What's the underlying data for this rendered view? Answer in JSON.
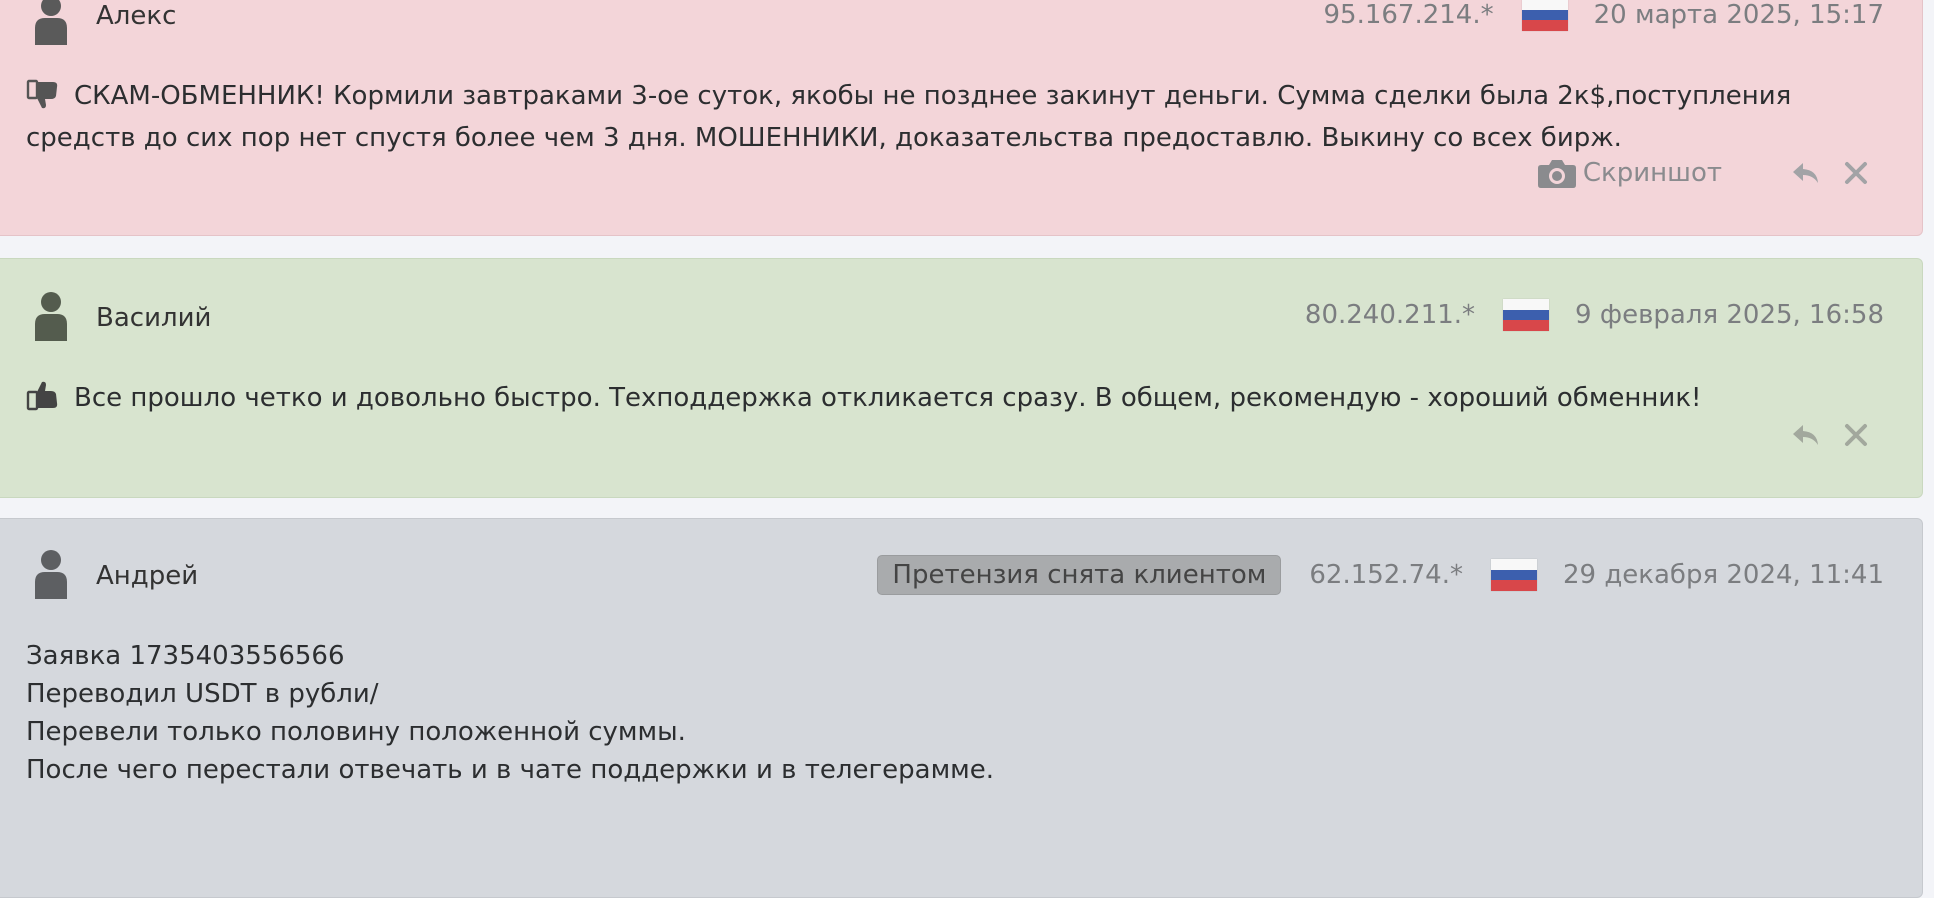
{
  "reviews": [
    {
      "author": "Алекс",
      "ip": "95.167.214.*",
      "date": "20 марта 2025, 15:17",
      "sentiment": "negative",
      "text": "СКАМ-ОБМЕННИК! Кормили завтраками 3-ое суток, якобы не позднее закинут деньги. Сумма сделки была 2к$,поступления средств до сих пор нет спустя более чем 3 дня. МОШЕННИКИ, доказательства предоставлю. Выкину со всех бирж.",
      "screenshot_label": "Скриншот"
    },
    {
      "author": "Василий",
      "ip": "80.240.211.*",
      "date": "9 февраля 2025, 16:58",
      "sentiment": "positive",
      "text": "Все прошло четко и довольно быстро. Техподдержка откликается сразу. В общем, рекомендую - хороший обменник!"
    },
    {
      "author": "Андрей",
      "ip": "62.152.74.*",
      "date": "29 декабря 2024, 11:41",
      "sentiment": "neutral",
      "status": "Претензия снята клиентом",
      "lines": [
        "Заявка 1735403556566",
        "Переводил USDT в рубли/",
        "Перевели только половину положенной суммы.",
        "После чего перестали отвечать и в чате поддержки и в телегерамме."
      ]
    }
  ],
  "colors": {
    "negative_bg": "#f3d5d9",
    "positive_bg": "#d8e4cf",
    "neutral_bg": "#d5d8dd",
    "page_bg": "#f3f4f8"
  },
  "icons": {
    "avatar": "user-silhouette-icon",
    "dislike": "thumbs-down-icon",
    "like": "thumbs-up-icon",
    "screenshot": "camera-icon",
    "reply": "reply-arrow-icon",
    "remove": "close-icon",
    "flag": "russia-flag-icon"
  }
}
